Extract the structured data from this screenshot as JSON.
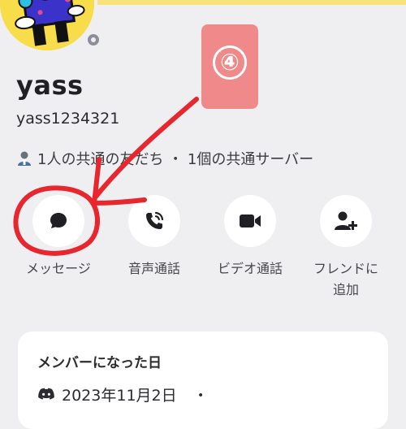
{
  "profile": {
    "display_name": "yass",
    "username": "yass1234321",
    "mutual_info": "1人の共通の友だち ・ 1個の共通サーバー"
  },
  "actions": [
    {
      "label": "メッセージ",
      "icon": "message-bubble-icon"
    },
    {
      "label": "音声通話",
      "icon": "phone-call-icon"
    },
    {
      "label": "ビデオ通話",
      "icon": "video-camera-icon"
    },
    {
      "label": "フレンドに\n追加",
      "icon": "add-friend-icon"
    }
  ],
  "member_since": {
    "title": "メンバーになった日",
    "date": "2023年11月2日",
    "trailing": "・"
  },
  "annotation": {
    "step": "④",
    "badge_color": "#f08a8a",
    "ink_color": "#e8262e"
  },
  "colors": {
    "avatar_bg": "#f7dd4a",
    "top_accent": "#f8e37a"
  }
}
